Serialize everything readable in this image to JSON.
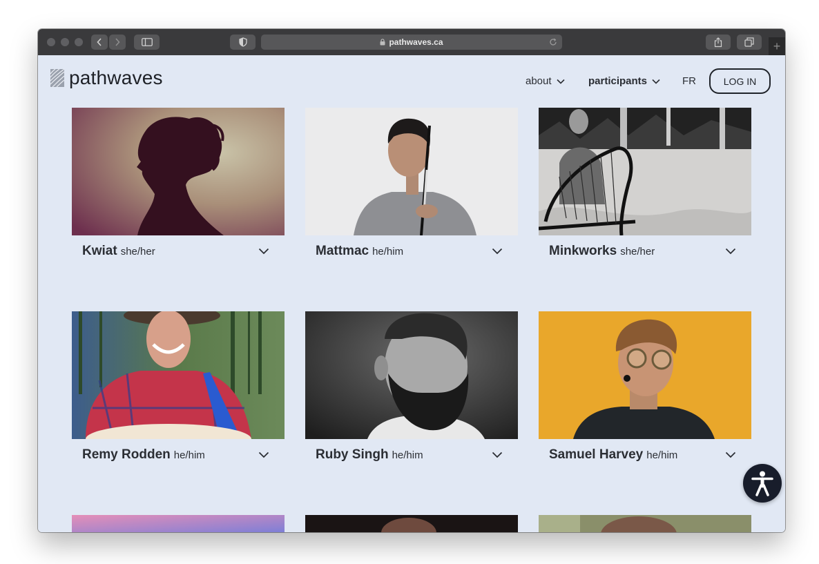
{
  "browser": {
    "url": "pathwaves.ca",
    "icons": [
      "back-icon",
      "forward-icon",
      "sidebar-icon",
      "shield-icon",
      "lock-icon",
      "reload-icon",
      "share-icon",
      "tabs-icon",
      "plus-icon"
    ]
  },
  "site": {
    "logo_text": "pathwaves",
    "nav": {
      "about": "about",
      "participants": "participants",
      "lang": "FR",
      "login": "LOG IN"
    }
  },
  "participants": [
    {
      "name": "Kwiat",
      "pronouns": "she/her"
    },
    {
      "name": "Mattmac",
      "pronouns": "he/him"
    },
    {
      "name": "Minkworks",
      "pronouns": "she/her"
    },
    {
      "name": "Remy Rodden",
      "pronouns": "he/him"
    },
    {
      "name": "Ruby Singh",
      "pronouns": "he/him"
    },
    {
      "name": "Samuel Harvey",
      "pronouns": "he/him"
    }
  ],
  "colors": {
    "page_bg": "#e1e8f4",
    "text": "#2b2e34",
    "accessibility_button": "#181d2b"
  }
}
